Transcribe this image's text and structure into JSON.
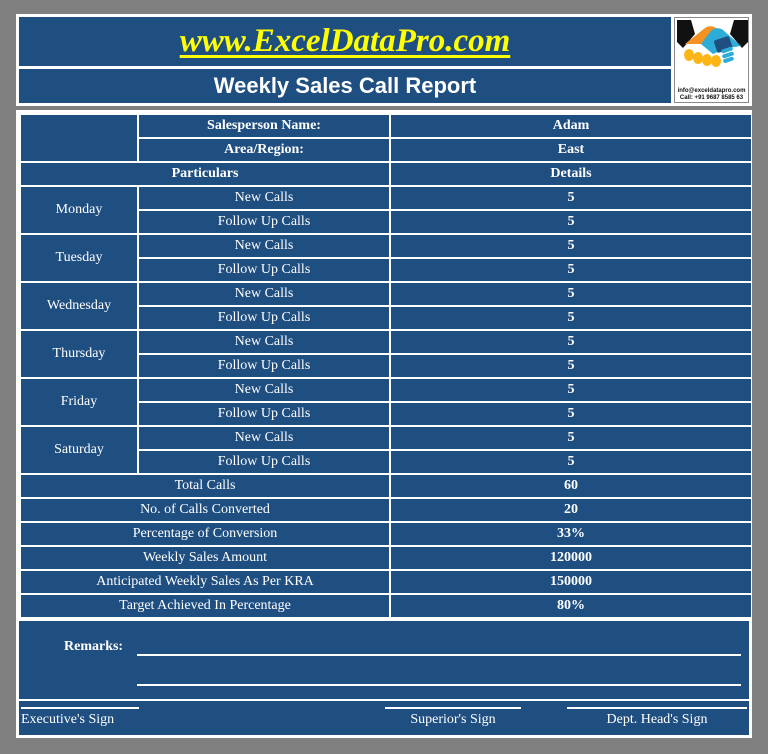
{
  "header": {
    "website": "www.ExcelDataPro.com",
    "title": "Weekly Sales Call Report",
    "logo": {
      "name": "handshake-logo",
      "email": "info@exceldatapro.com",
      "phone": "Call: +91 9687 8585 63"
    }
  },
  "info": {
    "salesperson_label": "Salesperson Name:",
    "salesperson_value": "Adam",
    "region_label": "Area/Region:",
    "region_value": "East"
  },
  "columns": {
    "particulars": "Particulars",
    "details": "Details"
  },
  "days": [
    {
      "name": "Monday",
      "rows": [
        {
          "label": "New Calls",
          "value": "5"
        },
        {
          "label": "Follow Up Calls",
          "value": "5"
        }
      ]
    },
    {
      "name": "Tuesday",
      "rows": [
        {
          "label": "New Calls",
          "value": "5"
        },
        {
          "label": "Follow Up Calls",
          "value": "5"
        }
      ]
    },
    {
      "name": "Wednesday",
      "rows": [
        {
          "label": "New Calls",
          "value": "5"
        },
        {
          "label": "Follow Up Calls",
          "value": "5"
        }
      ]
    },
    {
      "name": "Thursday",
      "rows": [
        {
          "label": "New Calls",
          "value": "5"
        },
        {
          "label": "Follow Up Calls",
          "value": "5"
        }
      ]
    },
    {
      "name": "Friday",
      "rows": [
        {
          "label": "New Calls",
          "value": "5"
        },
        {
          "label": "Follow Up Calls",
          "value": "5"
        }
      ]
    },
    {
      "name": "Saturday",
      "rows": [
        {
          "label": "New Calls",
          "value": "5"
        },
        {
          "label": "Follow Up Calls",
          "value": "5"
        }
      ]
    }
  ],
  "summary": [
    {
      "label": "Total Calls",
      "value": "60",
      "value_shade": "dark"
    },
    {
      "label": "No. of Calls Converted",
      "value": "20",
      "value_shade": "light"
    },
    {
      "label": "Percentage of Conversion",
      "value": "33%",
      "value_shade": "dark"
    },
    {
      "label": "Weekly Sales Amount",
      "value": "120000",
      "value_shade": "light"
    },
    {
      "label": "Anticipated Weekly Sales As Per KRA",
      "value": "150000",
      "value_shade": "light"
    },
    {
      "label": "Target Achieved In Percentage",
      "value": "80%",
      "value_shade": "dark"
    }
  ],
  "remarks": {
    "label": "Remarks:"
  },
  "signatures": {
    "executive": "Executive's Sign",
    "superior": "Superior's Sign",
    "dept_head": "Dept. Head's Sign"
  },
  "colors": {
    "dark_blue": "#1f4e81",
    "light_blue": "#4a84d1",
    "accent_yellow": "#ffff00",
    "page_bg": "#808080",
    "frame": "#ffffff"
  }
}
